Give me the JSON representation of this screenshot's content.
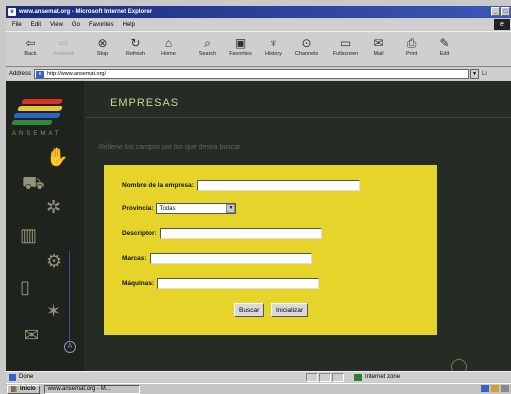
{
  "window": {
    "title": "www.ansemat.org - Microsoft Internet Explorer"
  },
  "menu": [
    "File",
    "Edit",
    "View",
    "Go",
    "Favorites",
    "Help"
  ],
  "toolbar": [
    {
      "label": "Back",
      "icon": "back-arrow-icon",
      "glyph": "⇦",
      "enabled": true
    },
    {
      "label": "Forward",
      "icon": "forward-arrow-icon",
      "glyph": "⇨",
      "enabled": false
    },
    {
      "label": "Stop",
      "icon": "stop-icon",
      "glyph": "⊗",
      "enabled": true
    },
    {
      "label": "Refresh",
      "icon": "refresh-icon",
      "glyph": "↻",
      "enabled": true
    },
    {
      "label": "Home",
      "icon": "home-icon",
      "glyph": "⌂",
      "enabled": true
    },
    {
      "label": "Search",
      "icon": "search-icon",
      "glyph": "⌕",
      "enabled": true
    },
    {
      "label": "Favorites",
      "icon": "favorites-icon",
      "glyph": "▣",
      "enabled": true
    },
    {
      "label": "History",
      "icon": "history-icon",
      "glyph": "♆",
      "enabled": true
    },
    {
      "label": "Channels",
      "icon": "channels-icon",
      "glyph": "⊙",
      "enabled": true
    },
    {
      "label": "Fullscreen",
      "icon": "fullscreen-icon",
      "glyph": "▭",
      "enabled": true
    },
    {
      "label": "Mail",
      "icon": "mail-icon",
      "glyph": "✉",
      "enabled": true
    },
    {
      "label": "Print",
      "icon": "print-icon",
      "glyph": "⎙",
      "enabled": true
    },
    {
      "label": "Edit",
      "icon": "edit-icon",
      "glyph": "✎",
      "enabled": true
    }
  ],
  "address": {
    "label": "Address",
    "value": "http://www.ansemat.org/",
    "links_label": "Li"
  },
  "site": {
    "logo_text": "ANSEMAT",
    "section_title": "EMPRESAS",
    "instructions": "Rellene los campos por los que desea buscar",
    "accent_color": "#e6d42a"
  },
  "form": {
    "company_label": "Nombre de la empresa:",
    "company_value": "",
    "province_label": "Provincia:",
    "province_value": "Todas",
    "descriptor_label": "Descriptor:",
    "descriptor_value": "",
    "brands_label": "Marcas:",
    "brands_value": "",
    "machines_label": "Máquinas:",
    "machines_value": "",
    "search_button": "Buscar",
    "reset_button": "Inicializar"
  },
  "status": {
    "text": "Done",
    "zone": "Internet zone"
  },
  "taskbar": {
    "start_label": "Inicio",
    "task_label": "www.ansemat.org - M..."
  }
}
